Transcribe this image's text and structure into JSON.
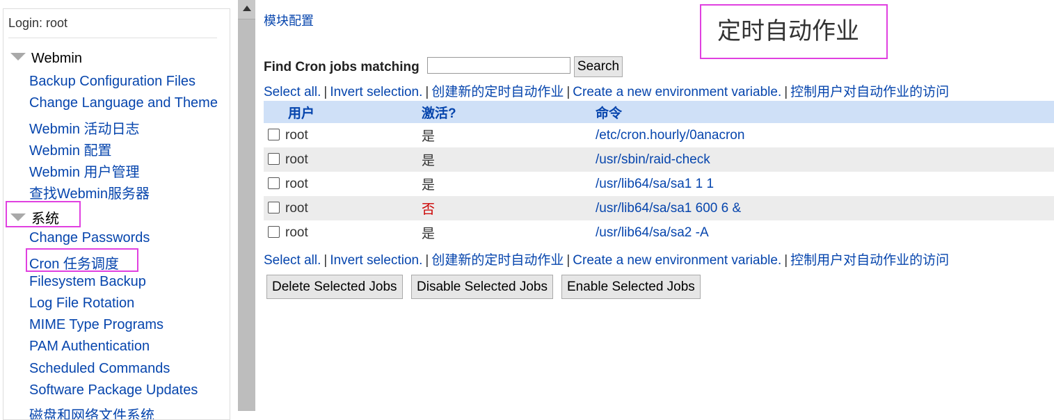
{
  "sidebar": {
    "login": "Login: root",
    "categories": [
      {
        "name": "Webmin",
        "items": [
          "Backup Configuration Files",
          "Change Language and Theme",
          "Webmin 活动日志",
          "Webmin 配置",
          "Webmin 用户管理",
          "查找Webmin服务器"
        ]
      },
      {
        "name": "系统",
        "items": [
          "Change Passwords",
          "Cron 任务调度",
          "Filesystem Backup",
          "Log File Rotation",
          "MIME Type Programs",
          "PAM Authentication",
          "Scheduled Commands",
          "Software Package Updates",
          "磁盘和网络文件系统"
        ]
      }
    ]
  },
  "main": {
    "module_config": "模块配置",
    "title": "定时自动作业",
    "search": {
      "label": "Find Cron jobs matching",
      "button": "Search",
      "value": ""
    },
    "links": {
      "select_all": "Select all.",
      "invert": "Invert selection.",
      "create_job": "创建新的定时自动作业",
      "create_env": "Create a new environment variable.",
      "control_access": "控制用户对自动作业的访问",
      "separator": "|"
    },
    "table": {
      "headers": [
        "用户",
        "激活?",
        "命令"
      ],
      "rows": [
        {
          "user": "root",
          "active": "是",
          "command": "/etc/cron.hourly/0anacron"
        },
        {
          "user": "root",
          "active": "是",
          "command": "/usr/sbin/raid-check"
        },
        {
          "user": "root",
          "active": "是",
          "command": "/usr/lib64/sa/sa1 1 1"
        },
        {
          "user": "root",
          "active": "否",
          "command": "/usr/lib64/sa/sa1 600 6 &"
        },
        {
          "user": "root",
          "active": "是",
          "command": "/usr/lib64/sa/sa2 -A"
        }
      ]
    },
    "buttons": {
      "delete": "Delete Selected Jobs",
      "disable": "Disable Selected Jobs",
      "enable": "Enable Selected Jobs"
    }
  },
  "colors": {
    "highlight": "#e040e0",
    "link": "#0645ad",
    "header_bg": "#cfe0f7",
    "inactive": "#cc0000"
  }
}
